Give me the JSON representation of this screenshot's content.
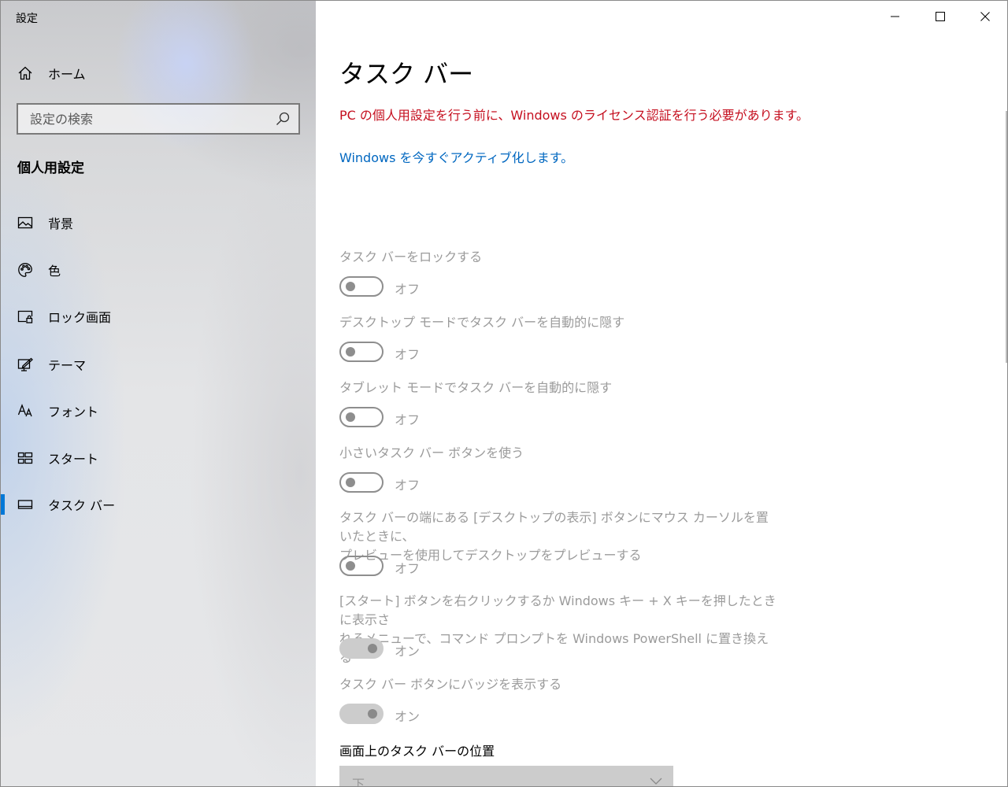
{
  "window": {
    "title": "設定"
  },
  "sidebar": {
    "home_label": "ホーム",
    "search_placeholder": "設定の検索",
    "section_title": "個人用設定",
    "items": [
      {
        "label": "背景",
        "icon": "picture-icon"
      },
      {
        "label": "色",
        "icon": "palette-icon"
      },
      {
        "label": "ロック画面",
        "icon": "lock-screen-icon"
      },
      {
        "label": "テーマ",
        "icon": "theme-icon"
      },
      {
        "label": "フォント",
        "icon": "font-icon"
      },
      {
        "label": "スタート",
        "icon": "start-icon"
      },
      {
        "label": "タスク バー",
        "icon": "taskbar-icon",
        "selected": true
      }
    ]
  },
  "main": {
    "title": "タスク バー",
    "warning": "PC の個人用設定を行う前に、Windows のライセンス認証を行う必要があります。",
    "activate_link": "Windows を今すぐアクティブ化します。",
    "settings": [
      {
        "label": "タスク バーをロックする",
        "state": "オフ",
        "on": false
      },
      {
        "label": "デスクトップ モードでタスク バーを自動的に隠す",
        "state": "オフ",
        "on": false
      },
      {
        "label": "タブレット モードでタスク バーを自動的に隠す",
        "state": "オフ",
        "on": false
      },
      {
        "label": "小さいタスク バー ボタンを使う",
        "state": "オフ",
        "on": false
      },
      {
        "label_line1": "タスク バーの端にある [デスクトップの表示] ボタンにマウス カーソルを置いたときに、",
        "label_line2": "プレビューを使用してデスクトップをプレビューする",
        "state": "オフ",
        "on": false
      },
      {
        "label_line1": "[スタート] ボタンを右クリックするか Windows キー + X キーを押したときに表示さ",
        "label_line2": "れるメニューで、コマンド プロンプトを Windows PowerShell に置き換える",
        "state": "オン",
        "on": true
      },
      {
        "label": "タスク バー ボタンにバッジを表示する",
        "state": "オン",
        "on": true
      }
    ],
    "position": {
      "label": "画面上のタスク バーの位置",
      "value": "下"
    }
  },
  "colors": {
    "accent": "#0078d7",
    "warning": "#c50f1f",
    "link": "#0067c0",
    "disabled_text": "#9b9b9b"
  }
}
